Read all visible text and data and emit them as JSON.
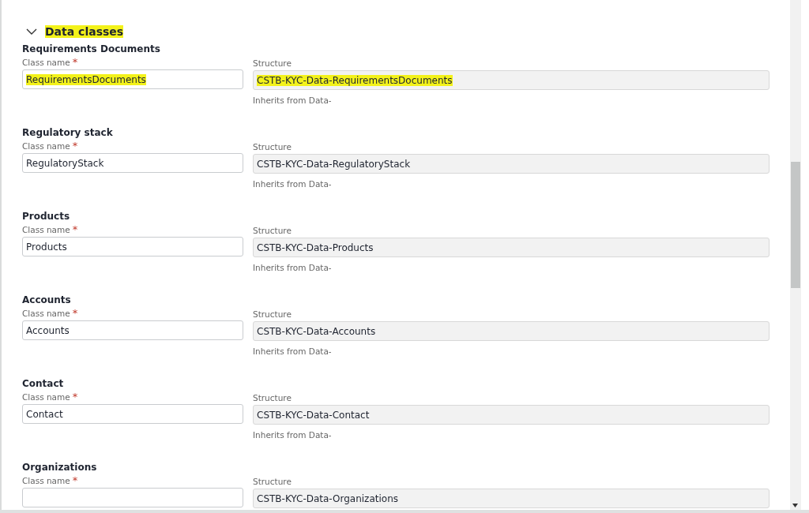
{
  "section": {
    "title": "Data classes",
    "expanded": true,
    "highlighted": true
  },
  "items": [
    {
      "heading": "Requirements Documents",
      "class_label": "Class name",
      "required_mark": "*",
      "class_value": "RequirementsDocuments",
      "class_highlighted": true,
      "structure_label": "Structure",
      "structure_value": "CSTB-KYC-Data-RequirementsDocuments",
      "structure_highlighted": true,
      "inherits": "Inherits from Data-"
    },
    {
      "heading": "Regulatory stack",
      "class_label": "Class name",
      "required_mark": "*",
      "class_value": "RegulatoryStack",
      "class_highlighted": false,
      "structure_label": "Structure",
      "structure_value": "CSTB-KYC-Data-RegulatoryStack",
      "structure_highlighted": false,
      "inherits": "Inherits from Data-"
    },
    {
      "heading": "Products",
      "class_label": "Class name",
      "required_mark": "*",
      "class_value": "Products",
      "class_highlighted": false,
      "structure_label": "Structure",
      "structure_value": "CSTB-KYC-Data-Products",
      "structure_highlighted": false,
      "inherits": "Inherits from Data-"
    },
    {
      "heading": "Accounts",
      "class_label": "Class name",
      "required_mark": "*",
      "class_value": "Accounts",
      "class_highlighted": false,
      "structure_label": "Structure",
      "structure_value": "CSTB-KYC-Data-Accounts",
      "structure_highlighted": false,
      "inherits": "Inherits from Data-"
    },
    {
      "heading": "Contact",
      "class_label": "Class name",
      "required_mark": "*",
      "class_value": "Contact",
      "class_highlighted": false,
      "structure_label": "Structure",
      "structure_value": "CSTB-KYC-Data-Contact",
      "structure_highlighted": false,
      "inherits": "Inherits from Data-"
    },
    {
      "heading": "Organizations",
      "class_label": "Class name",
      "required_mark": "*",
      "structure_label": "Structure",
      "structure_value": "CSTB-KYC-Data-Organizations",
      "structure_highlighted": false
    }
  ]
}
